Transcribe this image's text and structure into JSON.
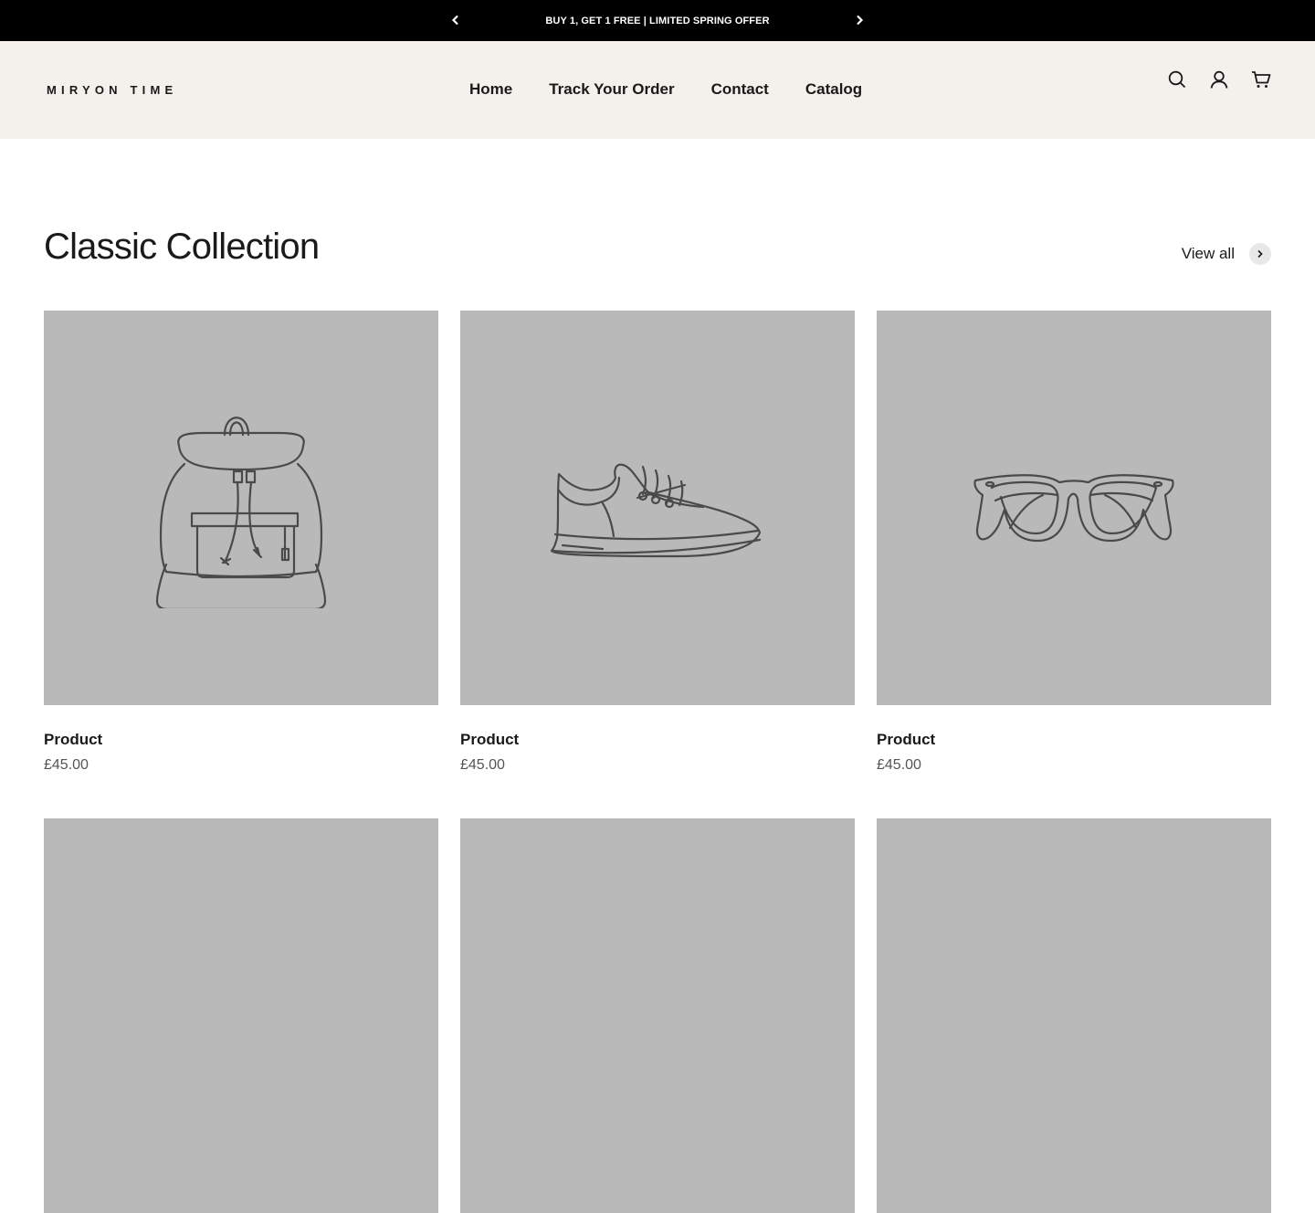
{
  "announcement": {
    "message": "BUY 1, GET 1 FREE | LIMITED SPRING OFFER"
  },
  "header": {
    "logo": "MIRYON TIME",
    "nav": [
      {
        "label": "Home"
      },
      {
        "label": "Track Your Order"
      },
      {
        "label": "Contact"
      },
      {
        "label": "Catalog"
      }
    ],
    "icons": [
      "search-icon",
      "account-icon",
      "cart-icon"
    ]
  },
  "collection": {
    "title": "Classic Collection",
    "view_all": "View all",
    "products": [
      {
        "name": "Product",
        "price": "£45.00",
        "image": "backpack"
      },
      {
        "name": "Product",
        "price": "£45.00",
        "image": "sneaker"
      },
      {
        "name": "Product",
        "price": "£45.00",
        "image": "sunglasses"
      }
    ]
  },
  "colors": {
    "announcement_bg": "#000000",
    "header_bg": "#f4f1ec",
    "placeholder_bg": "#b9b9b9",
    "text": "#1a1a1a"
  }
}
